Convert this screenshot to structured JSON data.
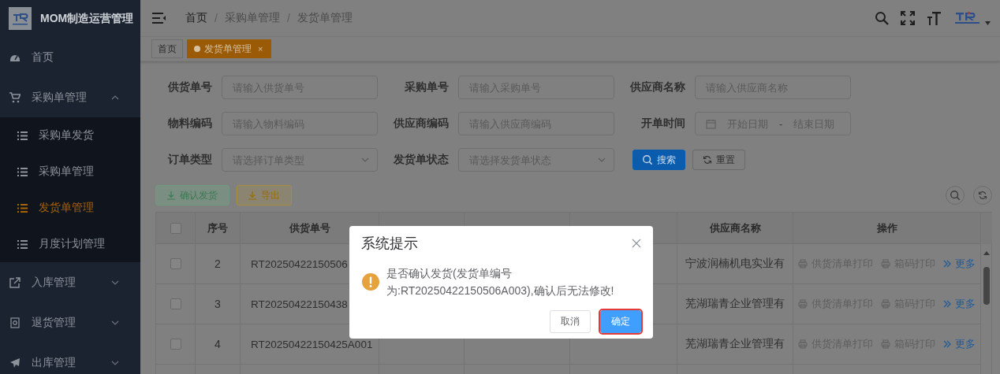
{
  "app": {
    "title": "MOM制造运营管理"
  },
  "sidebar": {
    "items": [
      {
        "kind": "link",
        "label": "首页",
        "selected": false
      },
      {
        "kind": "group",
        "label": "采购单管理",
        "expanded": true,
        "selected": false,
        "children": [
          {
            "label": "采购单发货",
            "selected": false
          },
          {
            "label": "采购单管理",
            "selected": false
          },
          {
            "label": "发货单管理",
            "selected": true
          },
          {
            "label": "月度计划管理",
            "selected": false
          }
        ]
      },
      {
        "kind": "group",
        "label": "入库管理",
        "expanded": false,
        "selected": false
      },
      {
        "kind": "group",
        "label": "退货管理",
        "expanded": false,
        "selected": false
      },
      {
        "kind": "group",
        "label": "出库管理",
        "expanded": false,
        "selected": false
      }
    ]
  },
  "header": {
    "breadcrumb": [
      {
        "label": "首页"
      },
      {
        "separator": "/",
        "label": "采购单管理"
      },
      {
        "separator": "/",
        "label": "发货单管理"
      }
    ]
  },
  "tabs": [
    {
      "label": "首页",
      "selected": false
    },
    {
      "label": "发货单管理",
      "selected": true,
      "close": "×"
    }
  ],
  "filters": [
    {
      "kind": "input",
      "label": "供货单号",
      "placeholder": "请输入供货单号"
    },
    {
      "kind": "input",
      "label": "采购单号",
      "placeholder": "请输入采购单号"
    },
    {
      "kind": "input",
      "label": "供应商名称",
      "placeholder": "请输入供应商名称"
    },
    {
      "kind": "input",
      "label": "物料编码",
      "placeholder": "请输入物料编码"
    },
    {
      "kind": "input",
      "label": "供应商编码",
      "placeholder": "请输入供应商编码"
    },
    {
      "kind": "daterange",
      "label": "开单时间",
      "start_placeholder": "开始日期",
      "separator": "-",
      "end_placeholder": "结束日期"
    },
    {
      "kind": "select",
      "label": "订单类型",
      "placeholder": "请选择订单类型"
    },
    {
      "kind": "select",
      "label": "发货单状态",
      "placeholder": "请选择发货单状态"
    }
  ],
  "filter_buttons": [
    {
      "kind": "primary",
      "label": "搜索"
    },
    {
      "kind": "default",
      "label": "重置"
    }
  ],
  "toolbar": [
    {
      "kind": "success",
      "label": "确认发货"
    },
    {
      "kind": "warning",
      "label": "导出"
    }
  ],
  "table": {
    "columns": [
      {
        "kind": "checkbox",
        "checked": false
      },
      {
        "kind": "text",
        "label": "序号"
      },
      {
        "kind": "text",
        "label": "供货单号"
      },
      {
        "kind": "covered"
      },
      {
        "kind": "covered"
      },
      {
        "kind": "covered"
      },
      {
        "kind": "text",
        "label": "供应商名称"
      },
      {
        "kind": "text",
        "label": "操作"
      }
    ],
    "rows": [
      {
        "cells": [
          {
            "kind": "checkbox",
            "checked": false
          },
          {
            "kind": "text",
            "text": "2"
          },
          {
            "kind": "id",
            "text": "RT20250422150506"
          },
          {
            "kind": "hidden"
          },
          {
            "kind": "hidden"
          },
          {
            "kind": "covered"
          },
          {
            "kind": "text",
            "text": "宁波润楠机电实业有"
          },
          {
            "kind": "actions",
            "actions": [
              {
                "kind": "print",
                "label": "供货清单打印"
              },
              {
                "kind": "print",
                "label": "箱码打印"
              },
              {
                "kind": "more",
                "label": "更多"
              }
            ]
          }
        ]
      },
      {
        "cells": [
          {
            "kind": "checkbox",
            "checked": false
          },
          {
            "kind": "text",
            "text": "3"
          },
          {
            "kind": "id",
            "text": "RT20250422150438"
          },
          {
            "kind": "hidden"
          },
          {
            "kind": "hidden"
          },
          {
            "kind": "covered"
          },
          {
            "kind": "text",
            "text": "芜湖瑞青企业管理有"
          },
          {
            "kind": "actions",
            "actions": [
              {
                "kind": "print",
                "label": "供货清单打印"
              },
              {
                "kind": "print",
                "label": "箱码打印"
              },
              {
                "kind": "more",
                "label": "更多"
              }
            ]
          }
        ]
      },
      {
        "cells": [
          {
            "kind": "checkbox",
            "checked": false
          },
          {
            "kind": "text",
            "text": "4"
          },
          {
            "kind": "id",
            "text": "RT20250422150425A001"
          },
          {
            "kind": "covered"
          },
          {
            "kind": "covered"
          },
          {
            "kind": "covered"
          },
          {
            "kind": "text",
            "text": "芜湖瑞青企业管理有"
          },
          {
            "kind": "actions",
            "actions": [
              {
                "kind": "print",
                "label": "供货清单打印"
              },
              {
                "kind": "print",
                "label": "箱码打印"
              },
              {
                "kind": "more",
                "label": "更多"
              }
            ]
          }
        ]
      }
    ]
  },
  "dialog": {
    "title": "系统提示",
    "message": "是否确认发货(发货单编号为:RT20250422150506A003),确认后无法修改!",
    "buttons": [
      {
        "kind": "default",
        "label": "取消",
        "focused": false
      },
      {
        "kind": "primary",
        "label": "确定",
        "focused": true
      }
    ]
  }
}
